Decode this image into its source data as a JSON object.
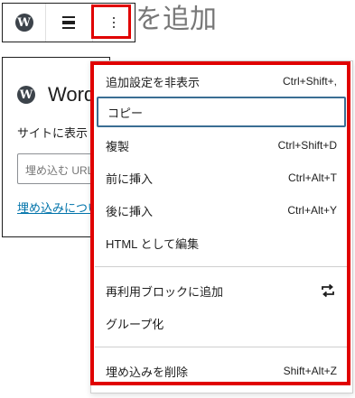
{
  "editor": {
    "title_fragment": "を追加"
  },
  "toolbar": {
    "block_icon": "wordpress-icon",
    "align_icon": "align-icon",
    "more_icon": "more-vertical-icon"
  },
  "embed": {
    "title": "WordPress",
    "description": "サイトに表示",
    "input_placeholder": "埋め込む URL",
    "learn_more": "埋め込みについて"
  },
  "menu": {
    "items": [
      {
        "label": "追加設定を非表示",
        "shortcut": "Ctrl+Shift+,"
      },
      {
        "label": "コピー",
        "shortcut": ""
      },
      {
        "label": "複製",
        "shortcut": "Ctrl+Shift+D"
      },
      {
        "label": "前に挿入",
        "shortcut": "Ctrl+Alt+T"
      },
      {
        "label": "後に挿入",
        "shortcut": "Ctrl+Alt+Y"
      },
      {
        "label": "HTML として編集",
        "shortcut": ""
      },
      {
        "label": "再利用ブロックに追加",
        "icon": "reusable-block-icon"
      },
      {
        "label": "グループ化",
        "shortcut": ""
      },
      {
        "label": "埋め込みを削除",
        "shortcut": "Shift+Alt+Z"
      }
    ]
  },
  "colors": {
    "highlight": "#e00000",
    "focus": "#3a6e93",
    "link": "#0073aa"
  }
}
